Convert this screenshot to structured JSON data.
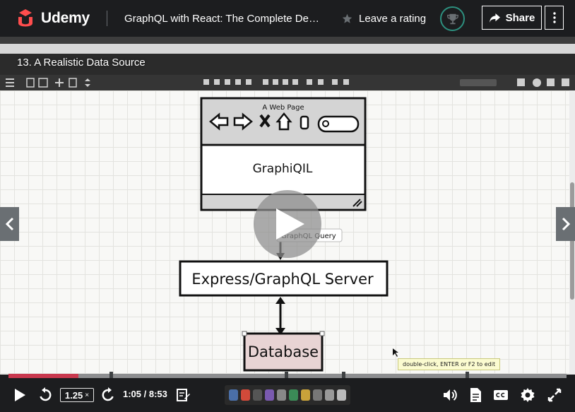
{
  "header": {
    "brand": "Udemy",
    "course_title": "GraphQL with React: The Complete Develo...",
    "rating_label": "Leave a rating",
    "share_label": "Share",
    "accent_color": "#a435f0",
    "logo_color": "#ff4d4d"
  },
  "video": {
    "lecture_title": "13. A Realistic Data Source",
    "diagram": {
      "browser_title": "A Web Page",
      "client_label": "GraphiQIL",
      "query_label": "GraphQL Query",
      "server_label": "Express/GraphQL Server",
      "database_label": "Database"
    },
    "tooltip": "double-click, ENTER or F2 to edit"
  },
  "player": {
    "progress_fraction": 0.125,
    "speed": "1.25",
    "speed_suffix": "×",
    "current_time": "1:05",
    "duration": "8:53",
    "time_display": "1:05 / 8:53"
  }
}
